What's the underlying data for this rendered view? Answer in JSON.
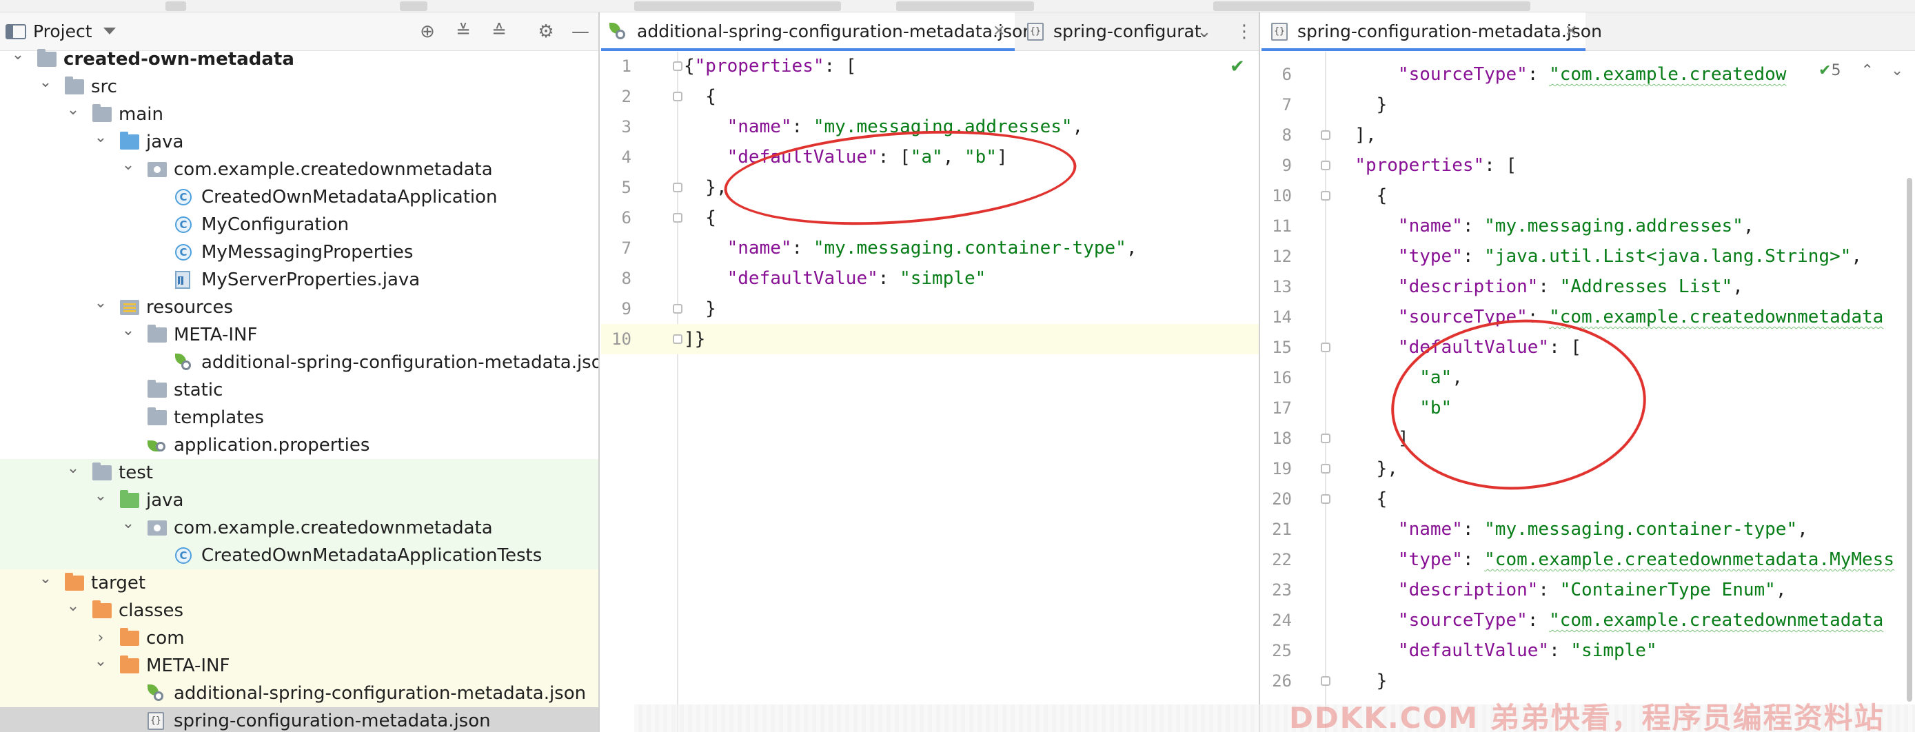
{
  "project_pane": {
    "title": "Project",
    "tree": [
      {
        "label": "created-own-metadata",
        "kind": "module",
        "depth": 0,
        "expanded": true,
        "bold": true
      },
      {
        "label": "src",
        "kind": "folder",
        "depth": 1,
        "expanded": true
      },
      {
        "label": "main",
        "kind": "folder",
        "depth": 2,
        "expanded": true
      },
      {
        "label": "java",
        "kind": "source-folder",
        "depth": 3,
        "expanded": true
      },
      {
        "label": "com.example.createdownmetadata",
        "kind": "package",
        "depth": 4,
        "expanded": true
      },
      {
        "label": "CreatedOwnMetadataApplication",
        "kind": "spring-class",
        "depth": 5
      },
      {
        "label": "MyConfiguration",
        "kind": "class",
        "depth": 5
      },
      {
        "label": "MyMessagingProperties",
        "kind": "class",
        "depth": 5
      },
      {
        "label": "MyServerProperties.java",
        "kind": "java-file",
        "depth": 5
      },
      {
        "label": "resources",
        "kind": "resources-folder",
        "depth": 3,
        "expanded": true
      },
      {
        "label": "META-INF",
        "kind": "folder",
        "depth": 4,
        "expanded": true
      },
      {
        "label": "additional-spring-configuration-metadata.json",
        "kind": "spring-json",
        "depth": 5
      },
      {
        "label": "static",
        "kind": "folder",
        "depth": 4
      },
      {
        "label": "templates",
        "kind": "folder",
        "depth": 4
      },
      {
        "label": "application.properties",
        "kind": "properties",
        "depth": 4
      },
      {
        "label": "test",
        "kind": "folder",
        "depth": 2,
        "expanded": true
      },
      {
        "label": "java",
        "kind": "test-folder",
        "depth": 3,
        "expanded": true
      },
      {
        "label": "com.example.createdownmetadata",
        "kind": "package",
        "depth": 4,
        "expanded": true
      },
      {
        "label": "CreatedOwnMetadataApplicationTests",
        "kind": "spring-class",
        "depth": 5
      },
      {
        "label": "target",
        "kind": "excluded-folder",
        "depth": 1,
        "expanded": true
      },
      {
        "label": "classes",
        "kind": "excluded-folder",
        "depth": 2,
        "expanded": true
      },
      {
        "label": "com",
        "kind": "excluded-folder",
        "depth": 3,
        "expanded": false
      },
      {
        "label": "META-INF",
        "kind": "excluded-folder",
        "depth": 3,
        "expanded": true
      },
      {
        "label": "additional-spring-configuration-metadata.json",
        "kind": "spring-json",
        "depth": 4
      },
      {
        "label": "spring-configuration-metadata.json",
        "kind": "json",
        "depth": 4
      }
    ]
  },
  "left_editor": {
    "tabs": [
      {
        "label": "additional-spring-configuration-metadata.json",
        "active": true,
        "closable": true
      },
      {
        "label": "spring-configurat",
        "active": false
      }
    ],
    "lines": [
      [
        [
          "p",
          "{"
        ],
        [
          "k",
          "\"properties\""
        ],
        [
          "p",
          ": ["
        ]
      ],
      [
        [
          "p",
          "  {"
        ]
      ],
      [
        [
          "p",
          "    "
        ],
        [
          "k",
          "\"name\""
        ],
        [
          "p",
          ": "
        ],
        [
          "s",
          "\"my.messaging.addresses\""
        ],
        [
          "p",
          ","
        ]
      ],
      [
        [
          "p",
          "    "
        ],
        [
          "k",
          "\"defaultValue\""
        ],
        [
          "p",
          ": ["
        ],
        [
          "s",
          "\"a\""
        ],
        [
          "p",
          ", "
        ],
        [
          "s",
          "\"b\""
        ],
        [
          "p",
          "]"
        ]
      ],
      [
        [
          "p",
          "  },"
        ]
      ],
      [
        [
          "p",
          "  {"
        ]
      ],
      [
        [
          "p",
          "    "
        ],
        [
          "k",
          "\"name\""
        ],
        [
          "p",
          ": "
        ],
        [
          "s",
          "\"my.messaging.container-type\""
        ],
        [
          "p",
          ","
        ]
      ],
      [
        [
          "p",
          "    "
        ],
        [
          "k",
          "\"defaultValue\""
        ],
        [
          "p",
          ": "
        ],
        [
          "s",
          "\"simple\""
        ]
      ],
      [
        [
          "p",
          "  }"
        ]
      ],
      [
        [
          "p",
          "]}"
        ]
      ]
    ],
    "first_line_number": 1,
    "current_line": 10
  },
  "right_editor": {
    "tabs": [
      {
        "label": "spring-configuration-metadata.json",
        "active": true,
        "closable": true
      }
    ],
    "inspection_count": "5",
    "lines": [
      [
        [
          "p",
          "      "
        ],
        [
          "k",
          "\"sourceType\""
        ],
        [
          "p",
          ": "
        ],
        [
          "s",
          "\"com.example.createdow"
        ]
      ],
      [
        [
          "p",
          "    }"
        ]
      ],
      [
        [
          "p",
          "  ],"
        ]
      ],
      [
        [
          "p",
          "  "
        ],
        [
          "k",
          "\"properties\""
        ],
        [
          "p",
          ": ["
        ]
      ],
      [
        [
          "p",
          "    {"
        ]
      ],
      [
        [
          "p",
          "      "
        ],
        [
          "k",
          "\"name\""
        ],
        [
          "p",
          ": "
        ],
        [
          "s",
          "\"my.messaging.addresses\""
        ],
        [
          "p",
          ","
        ]
      ],
      [
        [
          "p",
          "      "
        ],
        [
          "k",
          "\"type\""
        ],
        [
          "p",
          ": "
        ],
        [
          "s",
          "\"java.util.List<java.lang.String>\""
        ],
        [
          "p",
          ","
        ]
      ],
      [
        [
          "p",
          "      "
        ],
        [
          "k",
          "\"description\""
        ],
        [
          "p",
          ": "
        ],
        [
          "s",
          "\"Addresses List\""
        ],
        [
          "p",
          ","
        ]
      ],
      [
        [
          "p",
          "      "
        ],
        [
          "k",
          "\"sourceType\""
        ],
        [
          "p",
          ": "
        ],
        [
          "s",
          "\"com.example.createdownmetadata"
        ]
      ],
      [
        [
          "p",
          "      "
        ],
        [
          "k",
          "\"defaultValue\""
        ],
        [
          "p",
          ": ["
        ]
      ],
      [
        [
          "p",
          "        "
        ],
        [
          "s",
          "\"a\""
        ],
        [
          "p",
          ","
        ]
      ],
      [
        [
          "p",
          "        "
        ],
        [
          "s",
          "\"b\""
        ]
      ],
      [
        [
          "p",
          "      ]"
        ]
      ],
      [
        [
          "p",
          "    },"
        ]
      ],
      [
        [
          "p",
          "    {"
        ]
      ],
      [
        [
          "p",
          "      "
        ],
        [
          "k",
          "\"name\""
        ],
        [
          "p",
          ": "
        ],
        [
          "s",
          "\"my.messaging.container-type\""
        ],
        [
          "p",
          ","
        ]
      ],
      [
        [
          "p",
          "      "
        ],
        [
          "k",
          "\"type\""
        ],
        [
          "p",
          ": "
        ],
        [
          "s",
          "\"com.example.createdownmetadata.MyMess"
        ]
      ],
      [
        [
          "p",
          "      "
        ],
        [
          "k",
          "\"description\""
        ],
        [
          "p",
          ": "
        ],
        [
          "s",
          "\"ContainerType Enum\""
        ],
        [
          "p",
          ","
        ]
      ],
      [
        [
          "p",
          "      "
        ],
        [
          "k",
          "\"sourceType\""
        ],
        [
          "p",
          ": "
        ],
        [
          "s",
          "\"com.example.createdownmetadata"
        ]
      ],
      [
        [
          "p",
          "      "
        ],
        [
          "k",
          "\"defaultValue\""
        ],
        [
          "p",
          ": "
        ],
        [
          "s",
          "\"simple\""
        ]
      ],
      [
        [
          "p",
          "    }"
        ]
      ]
    ],
    "first_line_number": 6
  },
  "watermark": "DDKK.COM 弟弟快看，程序员编程资料站"
}
